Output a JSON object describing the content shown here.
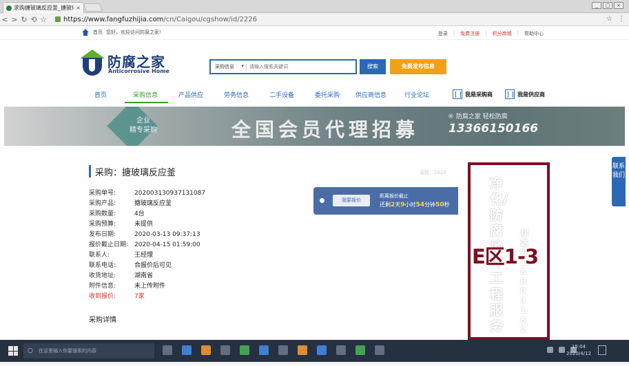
{
  "browser": {
    "tab_title": "求购搪玻璃反应釜_搪玻璃",
    "tab_close": "×",
    "url_host": "https://www.fangfuzhijia.com",
    "url_path": "/cn/Caigou/cgshow/id/2226",
    "back": "<",
    "forward": ">",
    "reload": "↻",
    "undo": "⟲",
    "star": "☆",
    "menu": "⋮",
    "min": "_",
    "max": "□",
    "close": "×"
  },
  "topstrip": {
    "home": "首页",
    "welcome": "您好，欢迎访问防腐之家!",
    "login": "登录",
    "register": "免费注册",
    "points_mall": "积分商城",
    "help": "帮助中心",
    "sep": "|"
  },
  "logo": {
    "cn": "防腐之家",
    "en": "Anticorrosive Home"
  },
  "search": {
    "category": "采购信息",
    "caret": "▾",
    "placeholder": "请输入搜索关键词",
    "button": "搜索",
    "publish": "免费发布信息"
  },
  "nav": {
    "items": [
      "首页",
      "采购信息",
      "产品供应",
      "劳务信息",
      "二手设备",
      "委托采购",
      "供应商信息",
      "行业论坛"
    ],
    "buyer": "我是采购商",
    "supplier": "我是供应商"
  },
  "banner": {
    "badge_line1": "企业",
    "badge_line2": "精专采购",
    "headline": "全国会员代理招募",
    "slogan": "® 防腐之家 轻松防腐",
    "phone": "13366150166"
  },
  "detail": {
    "title": "采购：搪玻璃反应釜",
    "faded_text": "采购：2020",
    "fields": [
      {
        "k": "采购单号:",
        "v": "202003130937131087"
      },
      {
        "k": "采购产品:",
        "v": "搪玻璃反应釜"
      },
      {
        "k": "采购数量:",
        "v": "4台"
      },
      {
        "k": "采购预算:",
        "v": "未提供"
      },
      {
        "k": "发布日期:",
        "v": "2020-03-13 09:37:13"
      },
      {
        "k": "报价截止日期:",
        "v": "2020-04-15 01:59:00"
      },
      {
        "k": "联系人:",
        "v": "王经理"
      },
      {
        "k": "联系电话:",
        "v": "合报价后可见"
      },
      {
        "k": "收货地址:",
        "v": "湖南省"
      },
      {
        "k": "附件信息:",
        "v": "未上传附件"
      }
    ],
    "received_k": "收到报价:",
    "received_v": "7家",
    "section": "采购详情"
  },
  "quote": {
    "button": "我要报价",
    "label": "距离报价截止",
    "prefix": "还剩",
    "days": "2",
    "days_u": "天",
    "hours": "9",
    "hours_u": "小时",
    "mins": "54",
    "mins_u": "分钟",
    "secs": "50",
    "secs_u": "秒"
  },
  "poster": {
    "line1": "净化/防腐地坪工程服务",
    "line2": "利达业 18603182",
    "zone": "E区1-3"
  },
  "side": {
    "contact": "联系我们"
  },
  "taskbar": {
    "search_placeholder": "在这里输入你要搜索的内容",
    "time": "15:04",
    "date": "2020/4/12"
  }
}
